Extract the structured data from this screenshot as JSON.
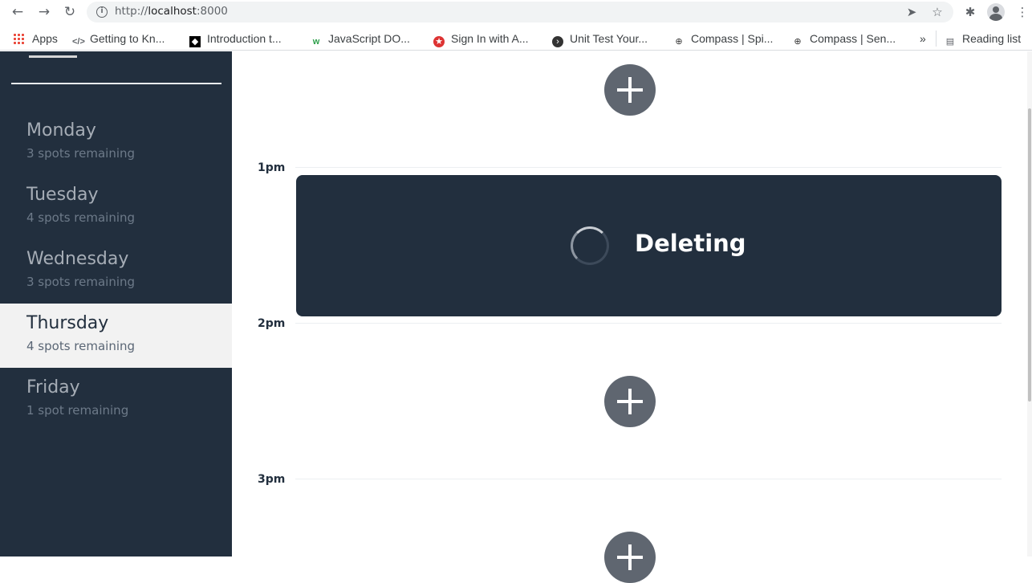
{
  "browser": {
    "url_scheme": "http://",
    "url_host": "localhost",
    "url_port": ":8000",
    "bookmarks": [
      {
        "label": "Apps"
      },
      {
        "label": "Getting to Kn..."
      },
      {
        "label": "Introduction t..."
      },
      {
        "label": "JavaScript DO..."
      },
      {
        "label": "Sign In with A..."
      },
      {
        "label": "Unit Test Your..."
      },
      {
        "label": "Compass | Spi..."
      },
      {
        "label": "Compass | Sen..."
      }
    ],
    "overflow_label": "»",
    "reading_list_label": "Reading list"
  },
  "sidebar": {
    "days": [
      {
        "name": "Monday",
        "spots": "3 spots remaining"
      },
      {
        "name": "Tuesday",
        "spots": "4 spots remaining"
      },
      {
        "name": "Wednesday",
        "spots": "3 spots remaining"
      },
      {
        "name": "Thursday",
        "spots": "4 spots remaining",
        "selected": true
      },
      {
        "name": "Friday",
        "spots": "1 spot remaining"
      }
    ]
  },
  "schedule": {
    "hours": [
      "1pm",
      "2pm",
      "3pm"
    ],
    "status_message": "Deleting"
  },
  "colors": {
    "sidebar_bg": "#222f3e",
    "selected_day_bg": "#f2f2f2",
    "add_button": "#5f6670",
    "card_bg": "#222f3e"
  }
}
